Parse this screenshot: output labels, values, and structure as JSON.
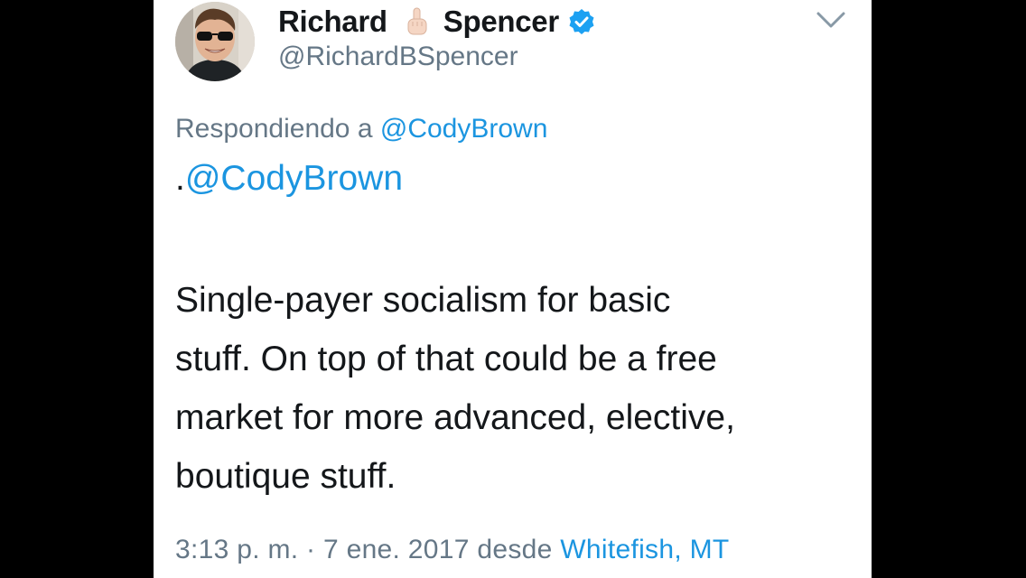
{
  "tweet": {
    "author": {
      "name_first": "Richard",
      "name_last": "Spencer",
      "handle": "@RichardBSpencer",
      "verified": true
    },
    "replying_to": {
      "prefix": "Respondiendo a",
      "mention": "@CodyBrown"
    },
    "mention_line": {
      "dot": ".",
      "mention": "@CodyBrown"
    },
    "body_lines": [
      "Single-payer socialism for basic",
      "stuff. On top of that could be a free",
      "market for more advanced, elective,",
      "boutique stuff."
    ],
    "meta": {
      "time_date": "3:13 p. m. · 7 ene. 2017 desde",
      "location": "Whitefish, MT"
    }
  },
  "icons": {
    "emoji": "pointing-up-hand-icon",
    "verified": "verified-badge-icon",
    "menu": "chevron-down-icon"
  },
  "colors": {
    "link": "#1b95e0",
    "secondary_text": "#657786",
    "primary_text": "#14171a",
    "verified_badge": "#1da1f2",
    "background": "#000000",
    "card": "#ffffff"
  }
}
